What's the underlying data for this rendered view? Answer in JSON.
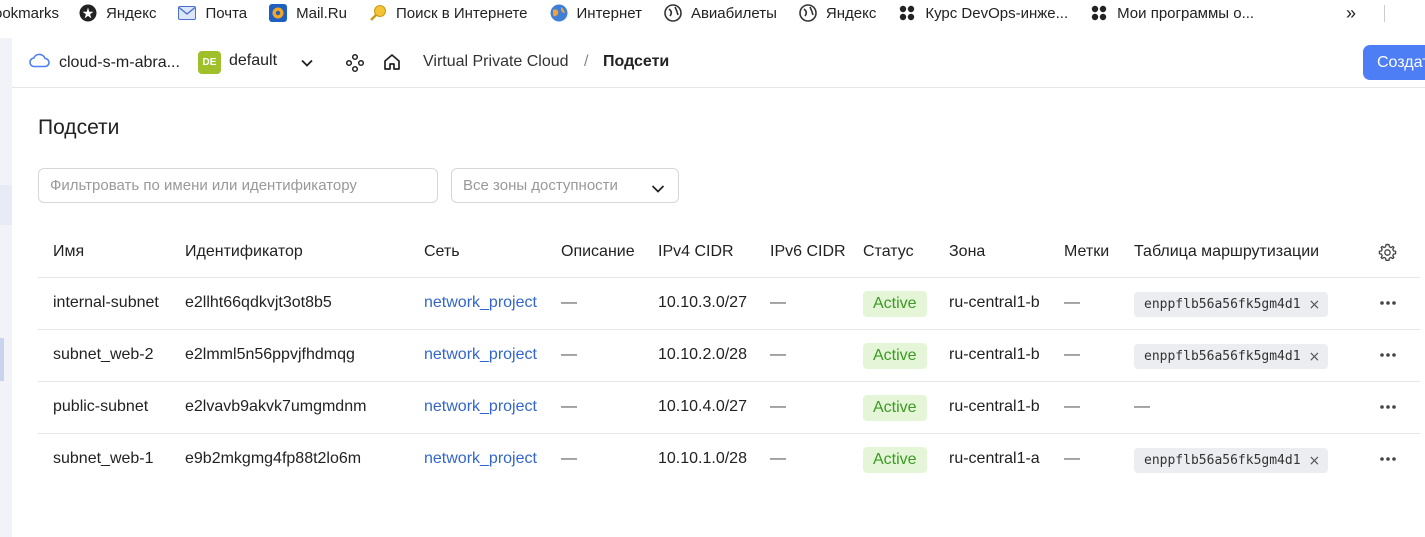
{
  "bookmarks": {
    "items": [
      {
        "label": "ookmarks",
        "icon": "bookmarks-folder-icon"
      },
      {
        "label": "Яндекс",
        "icon": "yandex-icon"
      },
      {
        "label": "Почта",
        "icon": "mail-icon"
      },
      {
        "label": "Mail.Ru",
        "icon": "mailru-icon"
      },
      {
        "label": "Поиск в Интернете",
        "icon": "search-key-icon"
      },
      {
        "label": "Интернет",
        "icon": "globe-icon"
      },
      {
        "label": "Авиабилеты",
        "icon": "globe-icon"
      },
      {
        "label": "Яндекс",
        "icon": "globe-icon"
      },
      {
        "label": "Курс DevOps-инже...",
        "icon": "flower-icon"
      },
      {
        "label": "Мои программы о...",
        "icon": "flower-icon"
      }
    ],
    "overflow": "»"
  },
  "header": {
    "cloud_name": "cloud-s-m-abra...",
    "folder_badge": "DE",
    "folder_name": "default",
    "breadcrumb": [
      "Virtual Private Cloud",
      "Подсети"
    ],
    "breadcrumb_sep": "/",
    "create_button": "Создать"
  },
  "page": {
    "title": "Подсети",
    "filter_placeholder": "Фильтровать по имени или идентификатору",
    "zone_select": "Все зоны доступности"
  },
  "table": {
    "columns": [
      "Имя",
      "Идентификатор",
      "Сеть",
      "Описание",
      "IPv4 CIDR",
      "IPv6 CIDR",
      "Статус",
      "Зона",
      "Метки",
      "Таблица маршрутизации"
    ],
    "rows": [
      {
        "name": "internal-subnet",
        "id": "e2llht66qdkvjt3ot8b5",
        "network": "network_project",
        "description": "—",
        "ipv4": "10.10.3.0/27",
        "ipv6": "—",
        "status": "Active",
        "zone": "ru-central1-b",
        "labels": "—",
        "route_table": "enppflb56a56fk5gm4d1"
      },
      {
        "name": "subnet_web-2",
        "id": "e2lmml5n56ppvjfhdmqg",
        "network": "network_project",
        "description": "—",
        "ipv4": "10.10.2.0/28",
        "ipv6": "—",
        "status": "Active",
        "zone": "ru-central1-b",
        "labels": "—",
        "route_table": "enppflb56a56fk5gm4d1"
      },
      {
        "name": "public-subnet",
        "id": "e2lvavb9akvk7umgmdnm",
        "network": "network_project",
        "description": "—",
        "ipv4": "10.10.4.0/27",
        "ipv6": "—",
        "status": "Active",
        "zone": "ru-central1-b",
        "labels": "—",
        "route_table": "—"
      },
      {
        "name": "subnet_web-1",
        "id": "e9b2mkgmg4fp88t2lo6m",
        "network": "network_project",
        "description": "—",
        "ipv4": "10.10.1.0/28",
        "ipv6": "—",
        "status": "Active",
        "zone": "ru-central1-a",
        "labels": "—",
        "route_table": "enppflb56a56fk5gm4d1"
      }
    ],
    "chip_close": "×"
  },
  "colors": {
    "accent": "#4d7ef5",
    "link": "#3366cc",
    "status_bg": "#e4f5d8",
    "status_text": "#3b9b22",
    "folder_badge": "#9fbf2b"
  }
}
